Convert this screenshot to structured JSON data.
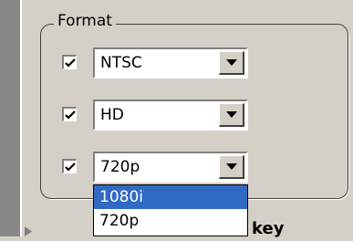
{
  "format_group": {
    "title": "Format",
    "rows": [
      {
        "checked": true,
        "value": "NTSC"
      },
      {
        "checked": true,
        "value": "HD"
      },
      {
        "checked": true,
        "value": "720p"
      }
    ]
  },
  "dropdown": {
    "options": [
      "1080i",
      "720p"
    ],
    "highlighted": "1080i"
  },
  "below": {
    "partial_label": "key"
  },
  "icons": {
    "check": "checkmark-icon",
    "combo_arrow": "chevron-down-icon",
    "row_arrow": "triangle-right-icon"
  },
  "colors": {
    "highlight": "#316ac5",
    "face": "#d4d0c8"
  }
}
